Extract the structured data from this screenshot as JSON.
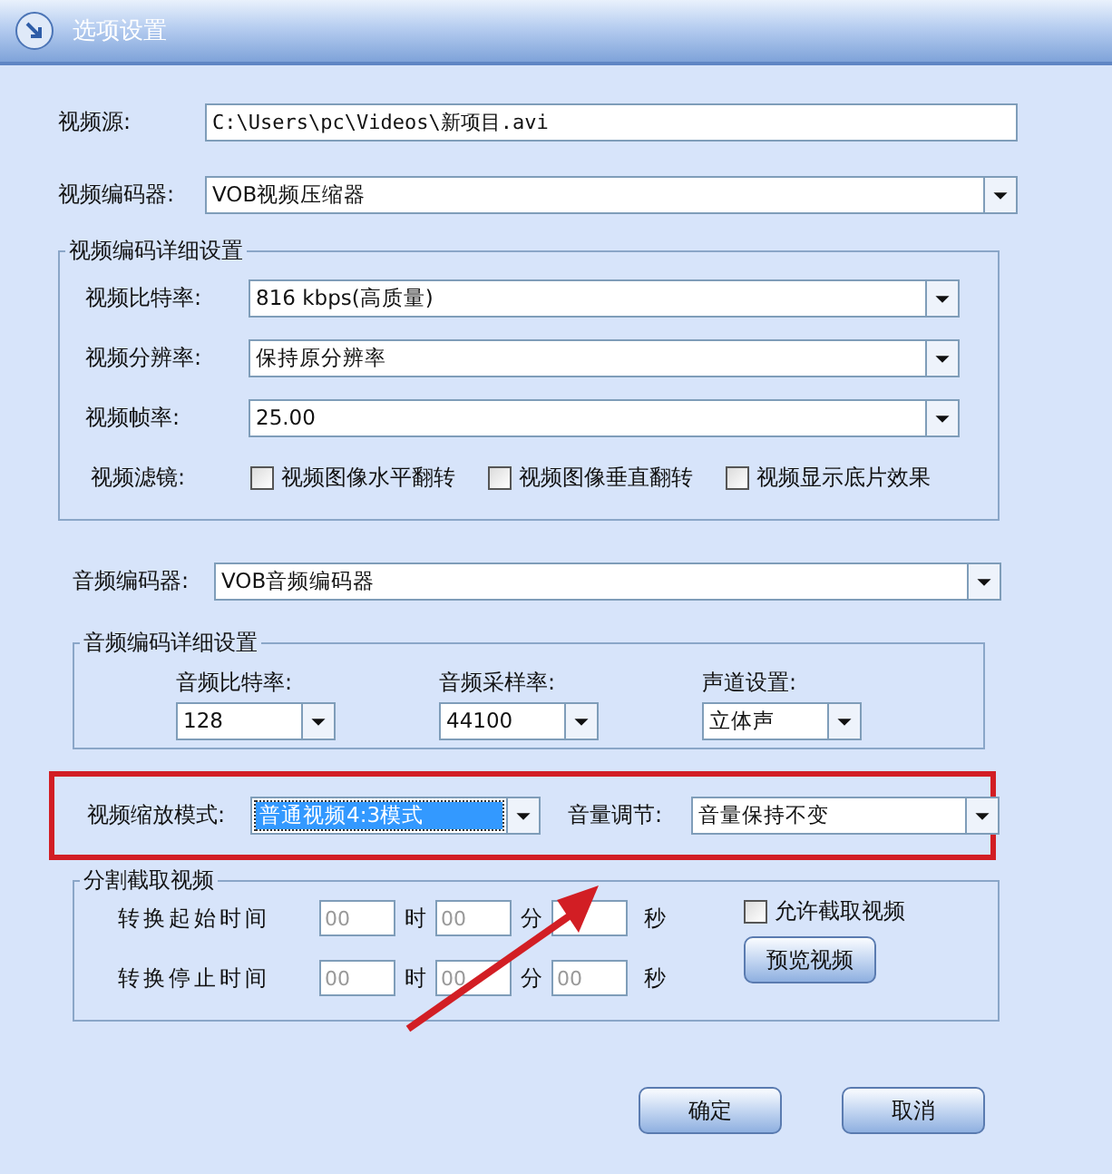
{
  "window": {
    "title": "选项设置"
  },
  "video_source": {
    "label": "视频源:",
    "value": "C:\\Users\\pc\\Videos\\新项目.avi"
  },
  "video_encoder": {
    "label": "视频编码器:",
    "value": "VOB视频压缩器"
  },
  "video_details": {
    "title": "视频编码详细设置",
    "selects": [
      {
        "label": "视频比特率:",
        "value": "816 kbps(高质量)"
      },
      {
        "label": "视频分辨率:",
        "value": "保持原分辨率"
      },
      {
        "label": "视频帧率:",
        "value": "25.00"
      }
    ],
    "filter_label": "视频滤镜:",
    "filters": [
      {
        "label": "视频图像水平翻转",
        "checked": false
      },
      {
        "label": "视频图像垂直翻转",
        "checked": false
      },
      {
        "label": "视频显示底片效果",
        "checked": false
      }
    ]
  },
  "audio_encoder": {
    "label": "音频编码器:",
    "value": "VOB音频编码器"
  },
  "audio_details": {
    "title": "音频编码详细设置",
    "selects": [
      {
        "label": "音频比特率:",
        "value": "128"
      },
      {
        "label": "音频采样率:",
        "value": "44100"
      },
      {
        "label": "声道设置:",
        "value": "立体声"
      }
    ]
  },
  "scale_mode": {
    "label": "视频缩放模式:",
    "value": "普通视频4:3模式",
    "selected": true
  },
  "volume": {
    "label": "音量调节:",
    "value": "音量保持不变"
  },
  "split": {
    "title": "分割截取视频",
    "rows": [
      {
        "label": "转换起始时间",
        "hours": "00",
        "hours_unit": "时",
        "minutes": "00",
        "minutes_unit": "分",
        "seconds_unit": "秒"
      },
      {
        "label": "转换停止时间",
        "hours": "00",
        "hours_unit": "时",
        "minutes": "00",
        "minutes_unit": "分",
        "seconds": "00",
        "seconds_unit": "秒"
      }
    ],
    "allow": {
      "label": "允许截取视频",
      "checked": false
    },
    "preview_button": "预览视频"
  },
  "buttons": [
    {
      "label": "确定"
    },
    {
      "label": "取消"
    }
  ]
}
